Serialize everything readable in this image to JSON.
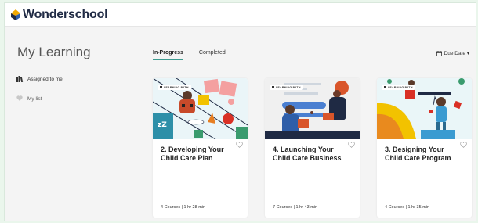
{
  "brand": {
    "name": "Wonderschool"
  },
  "sidebar": {
    "title": "My Learning",
    "items": [
      {
        "label": "Assigned to me",
        "icon": "books-icon"
      },
      {
        "label": "My list",
        "icon": "heart-icon"
      }
    ]
  },
  "tabs": [
    {
      "label": "In-Progress",
      "active": true
    },
    {
      "label": "Completed",
      "active": false
    }
  ],
  "sort": {
    "label": "Due Date"
  },
  "cards": [
    {
      "badge": "LEARNING PATH",
      "title": "2. Developing Your Child Care Plan",
      "meta": "4 Courses | 1 hr 28 min"
    },
    {
      "badge": "LEARNING PATH",
      "title": "4. Launching Your Child Care Business",
      "meta": "7 Courses | 1 hr 43 min"
    },
    {
      "badge": "LEARNING PATH",
      "title": "3. Designing Your Child Care Program",
      "meta": "4 Courses | 1 hr 35 min"
    }
  ],
  "colors": {
    "accent": "#3c9a8f",
    "brand_dark": "#1f2a44",
    "brand_gold": "#f2a900"
  }
}
